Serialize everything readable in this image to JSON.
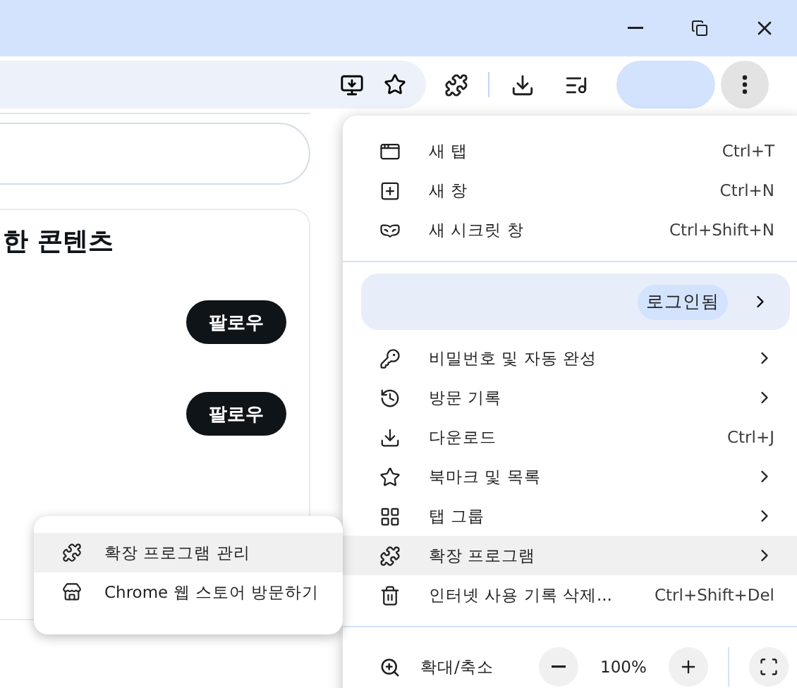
{
  "page": {
    "heading": "한 콘텐츠",
    "follow_buttons": [
      "팔로우",
      "팔로우"
    ]
  },
  "menu": {
    "groups": [
      [
        {
          "label": "새 탭",
          "shortcut": "Ctrl+T",
          "has_submenu": false,
          "selected": false
        },
        {
          "label": "새 창",
          "shortcut": "Ctrl+N",
          "has_submenu": false,
          "selected": false
        },
        {
          "label": "새 시크릿 창",
          "shortcut": "Ctrl+Shift+N",
          "has_submenu": false,
          "selected": false
        }
      ],
      [
        {
          "label": "비밀번호 및 자동 완성",
          "has_submenu": true,
          "selected": false
        },
        {
          "label": "방문 기록",
          "has_submenu": true,
          "selected": false
        },
        {
          "label": "다운로드",
          "shortcut": "Ctrl+J",
          "has_submenu": false,
          "selected": false
        },
        {
          "label": "북마크 및 목록",
          "has_submenu": true,
          "selected": false
        },
        {
          "label": "탭 그룹",
          "has_submenu": true,
          "selected": false
        },
        {
          "label": "확장 프로그램",
          "has_submenu": true,
          "selected": true
        },
        {
          "label": "인터넷 사용 기록 삭제...",
          "shortcut": "Ctrl+Shift+Del",
          "has_submenu": false,
          "selected": false
        }
      ]
    ],
    "profile": {
      "status": "로그인됨"
    },
    "zoom": {
      "label": "확대/축소",
      "value": "100%"
    }
  },
  "submenu": {
    "items": [
      {
        "label": "확장 프로그램 관리",
        "selected": true
      },
      {
        "label": "Chrome 웹 스토어 방문하기",
        "selected": false
      }
    ]
  }
}
